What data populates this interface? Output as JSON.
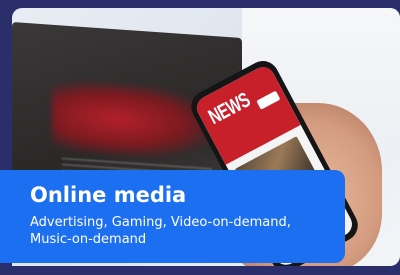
{
  "card": {
    "title": "Online media",
    "subtitle": "Advertising, Gaming, Video-on-demand, Music-on-demand"
  },
  "photo": {
    "phone_headline": "NEWS"
  },
  "colors": {
    "background": "#2a2f6b",
    "banner": "#1d6ff2",
    "banner_text": "#ffffff",
    "phone_header": "#c8202b"
  },
  "icons": {
    "photo": "smartphone-news-photo"
  }
}
